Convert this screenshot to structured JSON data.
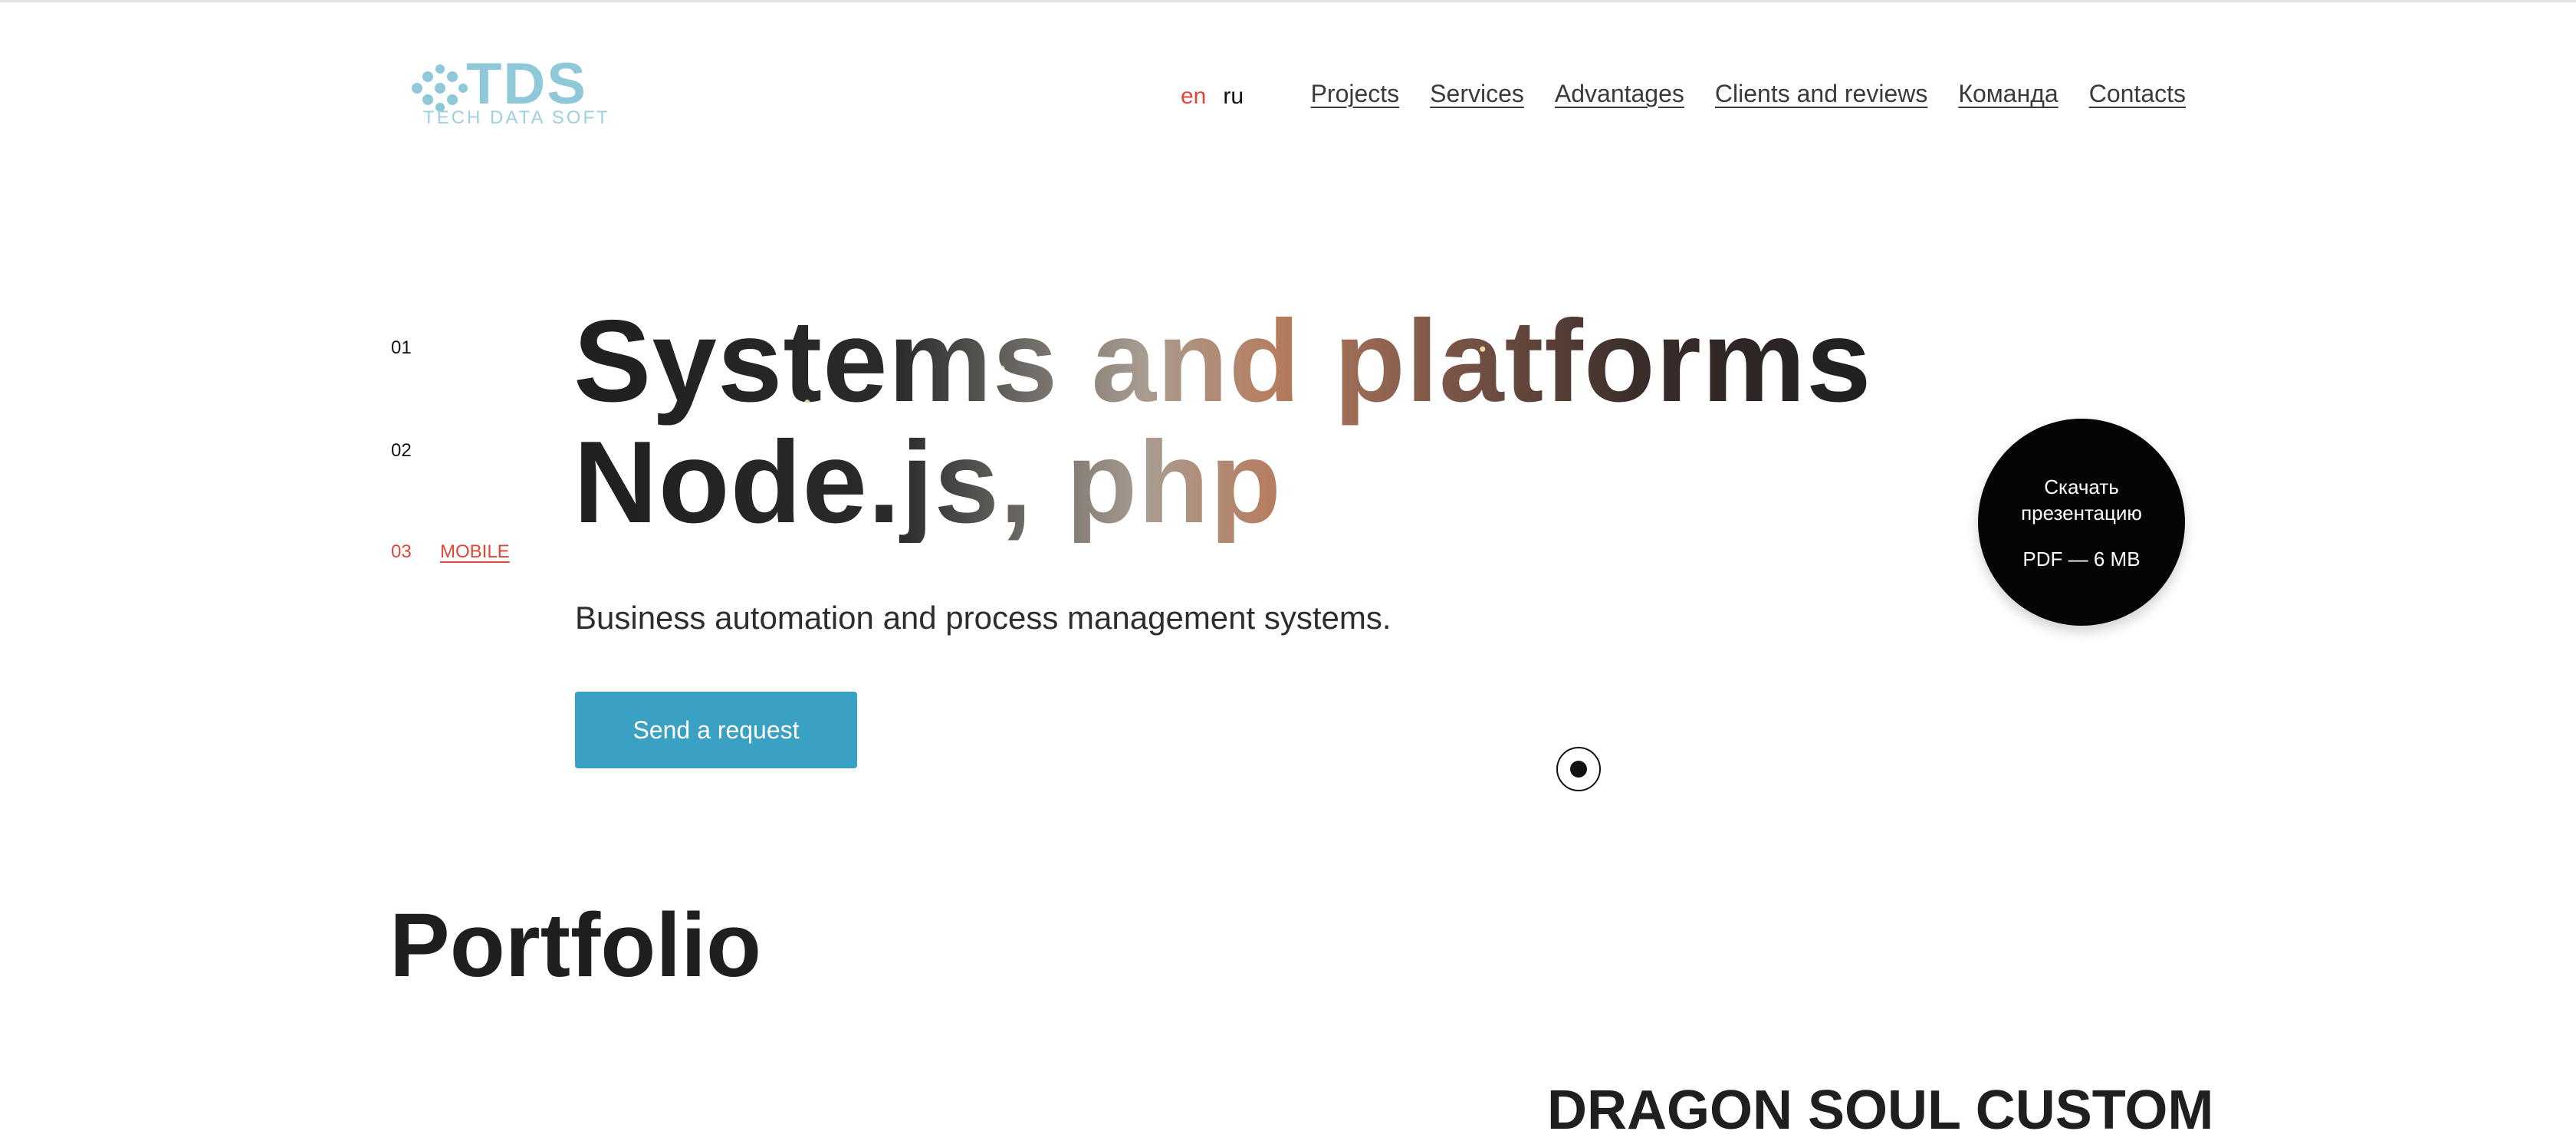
{
  "brand": {
    "name": "TDS",
    "tagline": "TECH DATA SOFT",
    "color": "#8fc8d9"
  },
  "header": {
    "languages": [
      {
        "label": "en",
        "active": true
      },
      {
        "label": "ru",
        "active": false
      }
    ],
    "nav": [
      "Projects",
      "Services",
      "Advantages",
      "Clients and reviews",
      "Команда",
      "Contacts"
    ]
  },
  "hero": {
    "slides": [
      {
        "number": "01",
        "label": ""
      },
      {
        "number": "02",
        "label": ""
      },
      {
        "number": "03",
        "label": "MOBILE"
      }
    ],
    "title_line_1": "Systems and platforms",
    "title_line_2": "Node.js, php",
    "subtitle": "Business automation and process management systems.",
    "cta_label": "Send a request",
    "cta_color": "#3aa1c4",
    "download": {
      "title": "Скачать презентацию",
      "meta": "PDF — 6 MB"
    }
  },
  "portfolio": {
    "title": "Portfolio",
    "first_project": "DRAGON SOUL CUSTOM"
  },
  "colors": {
    "accent": "#e1463a",
    "text": "#1f1f1f",
    "button": "#3aa1c4"
  }
}
